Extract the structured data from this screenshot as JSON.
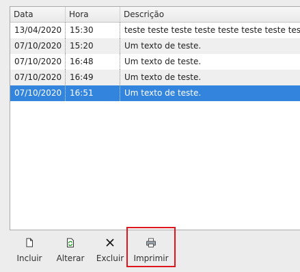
{
  "table": {
    "columns": [
      "Data",
      "Hora",
      "Descrição"
    ],
    "rows": [
      {
        "data": "13/04/2020",
        "hora": "15:30",
        "descricao": "teste teste teste teste teste teste teste teste"
      },
      {
        "data": "07/10/2020",
        "hora": "15:20",
        "descricao": "Um texto de teste."
      },
      {
        "data": "07/10/2020",
        "hora": "16:48",
        "descricao": "Um texto de teste."
      },
      {
        "data": "07/10/2020",
        "hora": "16:49",
        "descricao": "Um texto de teste."
      },
      {
        "data": "07/10/2020",
        "hora": "16:51",
        "descricao": "Um texto de teste."
      }
    ],
    "selected_row": 4
  },
  "toolbar": {
    "buttons": [
      {
        "label": "Incluir",
        "icon": "new-document-icon"
      },
      {
        "label": "Alterar",
        "icon": "refresh-document-icon"
      },
      {
        "label": "Excluir",
        "icon": "delete-x-icon"
      },
      {
        "label": "Imprimir",
        "icon": "printer-icon"
      }
    ]
  },
  "colors": {
    "selection": "#3384dd",
    "highlight_box": "#e0141b"
  }
}
